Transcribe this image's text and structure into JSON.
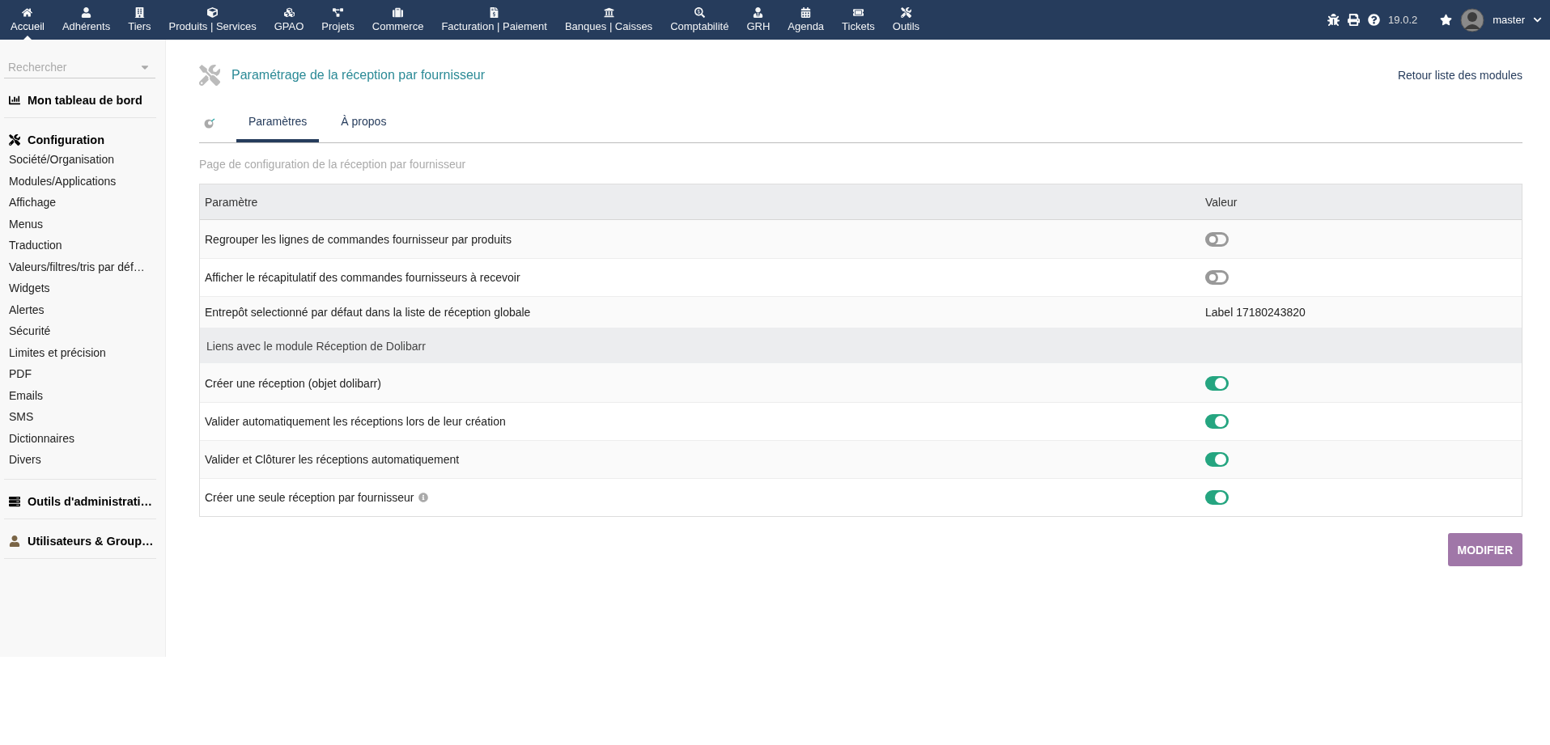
{
  "top_nav": {
    "items": [
      {
        "label": "Accueil",
        "selected": true
      },
      {
        "label": "Adhérents",
        "selected": false
      },
      {
        "label": "Tiers",
        "selected": false
      },
      {
        "label": "Produits | Services",
        "selected": false
      },
      {
        "label": "GPAO",
        "selected": false
      },
      {
        "label": "Projets",
        "selected": false
      },
      {
        "label": "Commerce",
        "selected": false
      },
      {
        "label": "Facturation | Paiement",
        "selected": false
      },
      {
        "label": "Banques | Caisses",
        "selected": false
      },
      {
        "label": "Comptabilité",
        "selected": false
      },
      {
        "label": "GRH",
        "selected": false
      },
      {
        "label": "Agenda",
        "selected": false
      },
      {
        "label": "Tickets",
        "selected": false
      },
      {
        "label": "Outils",
        "selected": false
      }
    ],
    "version": "19.0.2",
    "user": "master"
  },
  "sidebar": {
    "search": {
      "placeholder": "Rechercher"
    },
    "sections": [
      {
        "title": "Mon tableau de bord"
      },
      {
        "title": "Configuration",
        "items": [
          "Société/Organisation",
          "Modules/Applications",
          "Affichage",
          "Menus",
          "Traduction",
          "Valeurs/filtres/tris par déf…",
          "Widgets",
          "Alertes",
          "Sécurité",
          "Limites et précision",
          "PDF",
          "Emails",
          "SMS",
          "Dictionnaires",
          "Divers"
        ]
      },
      {
        "title": "Outils d'administrati…"
      },
      {
        "title": "Utilisateurs & Group…"
      }
    ]
  },
  "page": {
    "title": "Paramétrage de la réception par fournisseur",
    "back_link": "Retour liste des modules",
    "tabs": [
      {
        "label": "Paramètres",
        "selected": true
      },
      {
        "label": "À propos",
        "selected": false
      }
    ],
    "description": "Page de configuration de la réception par fournisseur",
    "table": {
      "columns": [
        "Paramètre",
        "Valeur"
      ],
      "rows": [
        {
          "kind": "toggle",
          "label": "Regrouper les lignes de commandes fournisseur par produits",
          "on": false
        },
        {
          "kind": "toggle",
          "label": "Afficher le récapitulatif des commandes fournisseurs à recevoir",
          "on": false
        },
        {
          "kind": "text",
          "label": "Entrepôt selectionné par défaut dans la liste de réception globale",
          "value": "Label 17180243820"
        },
        {
          "kind": "section",
          "label": "Liens avec le module Réception de Dolibarr"
        },
        {
          "kind": "toggle",
          "label": "Créer une réception (objet dolibarr)",
          "on": true
        },
        {
          "kind": "toggle",
          "label": "Valider automatiquement les réceptions lors de leur création",
          "on": true
        },
        {
          "kind": "toggle",
          "label": "Valider et Clôturer les réceptions automatiquement",
          "on": true
        },
        {
          "kind": "toggle",
          "label": "Créer une seule réception par fournisseur",
          "on": true,
          "info": true
        }
      ]
    },
    "button": "MODIFIER"
  }
}
